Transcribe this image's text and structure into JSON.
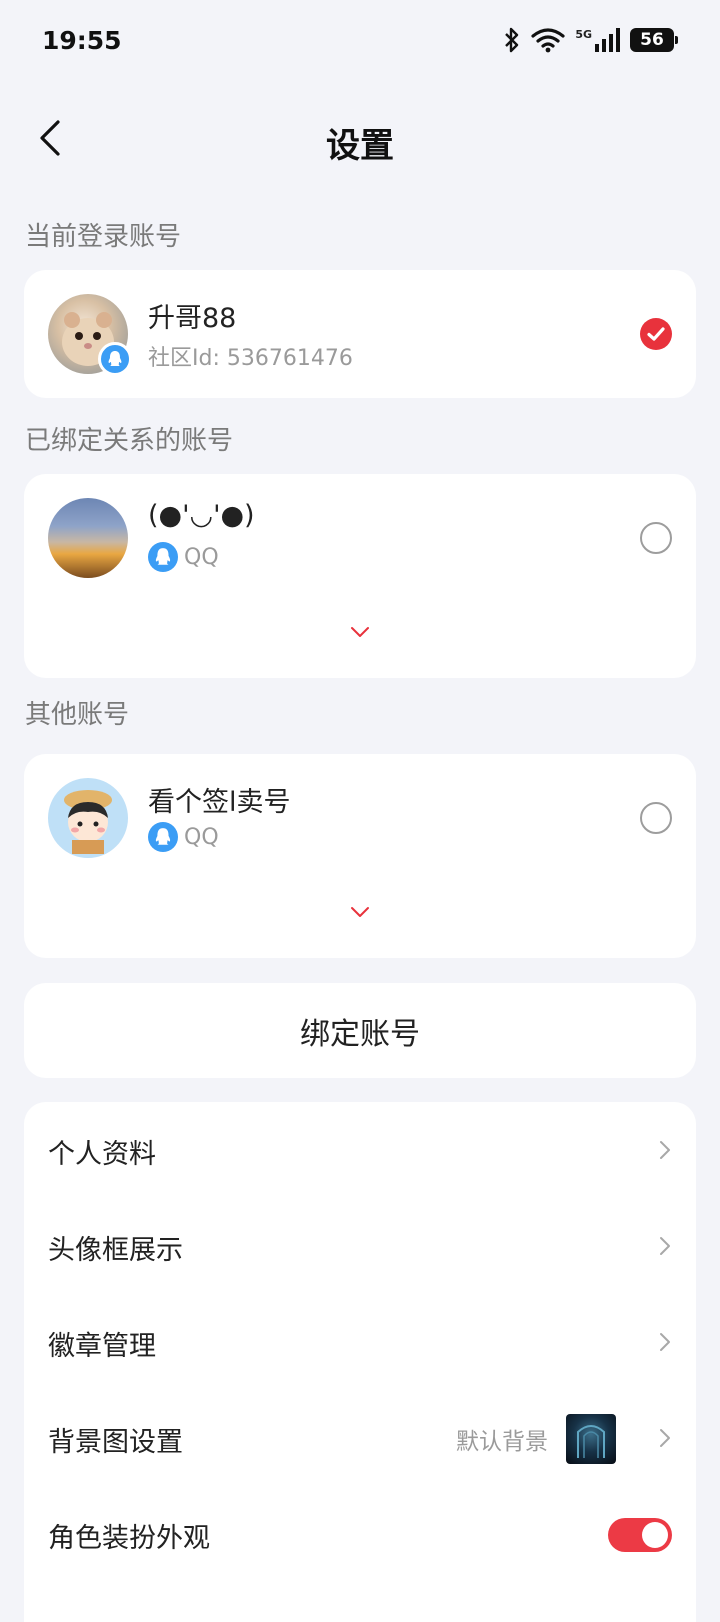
{
  "status": {
    "time": "19:55",
    "network": "5G",
    "battery": "56"
  },
  "nav": {
    "title": "设置"
  },
  "current_section": {
    "label": "当前登录账号",
    "account": {
      "name": "升哥88",
      "sub": "社区Id: 536761476",
      "selected": true
    }
  },
  "bound_section": {
    "label": "已绑定关系的账号",
    "account": {
      "name": "(●'◡'●)",
      "sub": "QQ",
      "selected": false
    }
  },
  "other_section": {
    "label": "其他账号",
    "account": {
      "name": "看个签l卖号",
      "sub": "QQ",
      "selected": false
    }
  },
  "bind_button": {
    "label": "绑定账号"
  },
  "menu": {
    "items": [
      {
        "label": "个人资料"
      },
      {
        "label": "头像框展示"
      },
      {
        "label": "徽章管理"
      },
      {
        "label": "背景图设置",
        "value": "默认背景"
      },
      {
        "label": "角色装扮外观",
        "toggle": true
      }
    ]
  },
  "colors": {
    "accent": "#e8323c",
    "qq_blue": "#3b9df5",
    "background": "#f3f4f9"
  }
}
